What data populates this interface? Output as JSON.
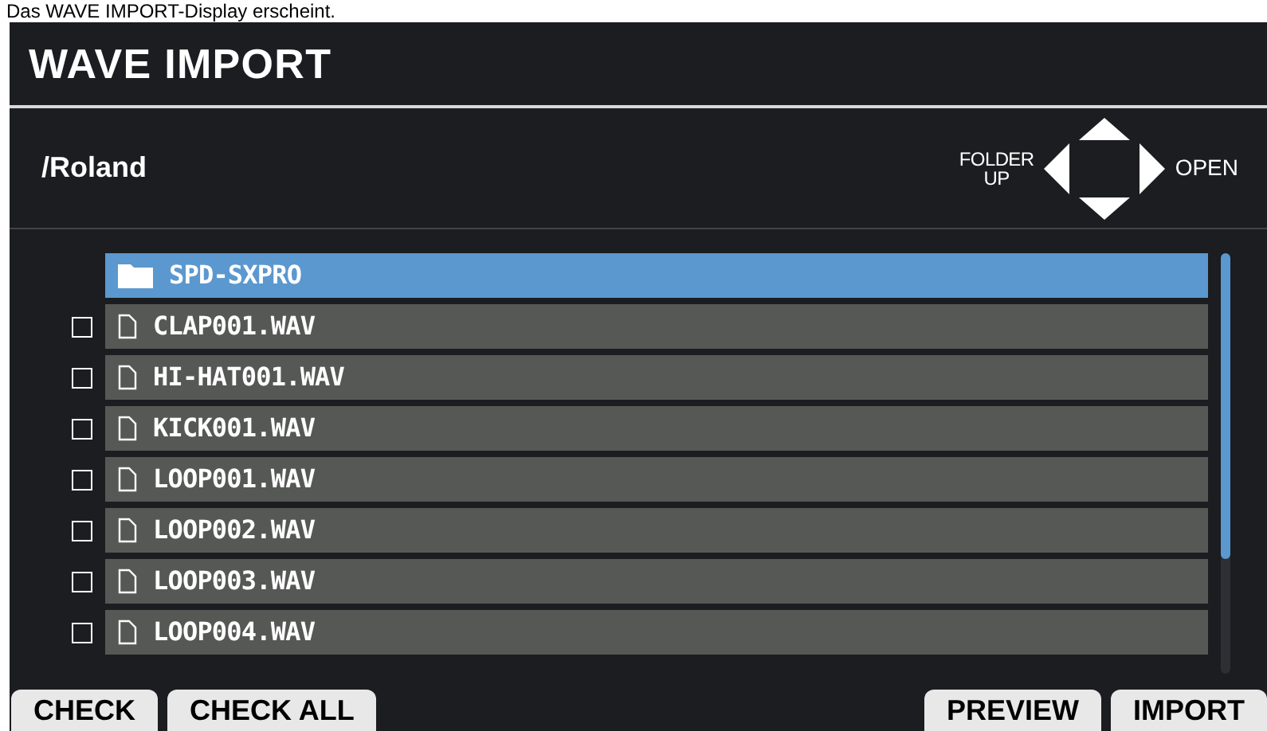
{
  "caption": "Das WAVE IMPORT-Display erscheint.",
  "screen": {
    "title": "WAVE IMPORT",
    "path": "/Roland",
    "nav_left": "FOLDER UP",
    "nav_right": "OPEN",
    "items": [
      {
        "kind": "folder",
        "name": "SPD-SXPRO",
        "selected": true
      },
      {
        "kind": "file",
        "name": "CLAP001.WAV",
        "selected": false,
        "checked": false
      },
      {
        "kind": "file",
        "name": "HI-HAT001.WAV",
        "selected": false,
        "checked": false
      },
      {
        "kind": "file",
        "name": "KICK001.WAV",
        "selected": false,
        "checked": false
      },
      {
        "kind": "file",
        "name": "LOOP001.WAV",
        "selected": false,
        "checked": false
      },
      {
        "kind": "file",
        "name": "LOOP002.WAV",
        "selected": false,
        "checked": false
      },
      {
        "kind": "file",
        "name": "LOOP003.WAV",
        "selected": false,
        "checked": false
      },
      {
        "kind": "file",
        "name": "LOOP004.WAV",
        "selected": false,
        "checked": false
      }
    ],
    "buttons_left": [
      "CHECK",
      "CHECK ALL"
    ],
    "buttons_right": [
      "PREVIEW",
      "IMPORT"
    ]
  }
}
